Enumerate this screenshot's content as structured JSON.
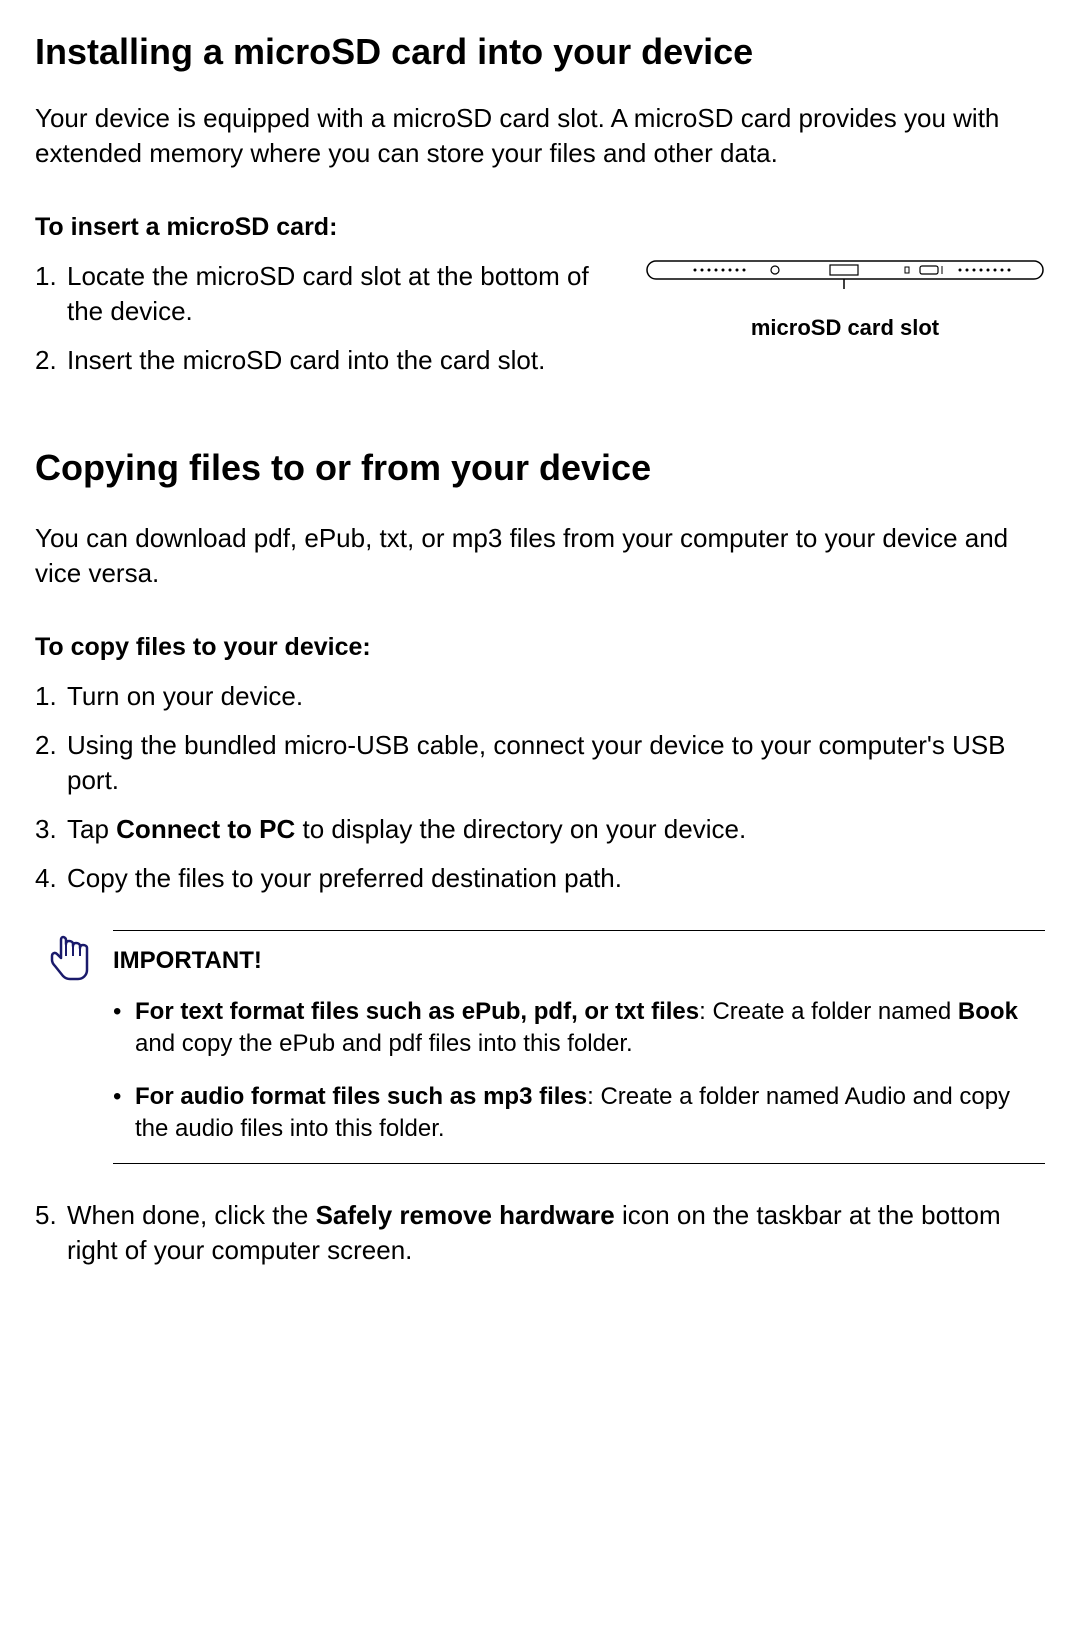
{
  "section1": {
    "title": "Installing a microSD card into your device",
    "intro": "Your device is equipped with a microSD card slot. A microSD card provides you with extended memory where you can store your files and other data.",
    "subheading": "To insert a microSD card:",
    "steps": [
      "Locate the microSD card slot at the bottom of the device.",
      "Insert the microSD card into the card slot."
    ],
    "figure_label": "microSD card slot"
  },
  "section2": {
    "title": "Copying files to or from your device",
    "intro": "You can download pdf, ePub, txt, or mp3 files from your computer to your device and vice versa.",
    "subheading": "To copy files to your device:",
    "steps": [
      "Turn on your device.",
      "Using the bundled micro-USB cable, connect your device to your computer's USB port.",
      "Tap <b>Connect to PC</b> to display the directory on your device.",
      "Copy the files to your preferred destination path."
    ],
    "important": {
      "title": "IMPORTANT!",
      "items": [
        "<b>For text format files such as ePub, pdf, or txt files</b>: Create a folder named <b>Book</b> and copy the ePub and pdf files into this folder.",
        "<b>For audio format files such as mp3 files</b>: Create a folder named Audio and copy the audio files into this folder."
      ]
    },
    "step5": "When done, click the <b>Safely remove hardware</b> icon on the taskbar at the bottom right of your computer screen."
  }
}
